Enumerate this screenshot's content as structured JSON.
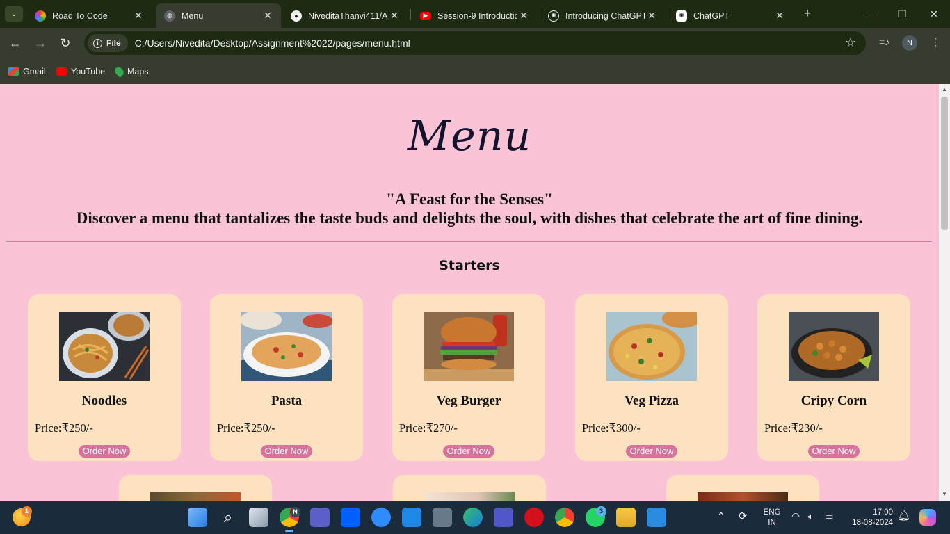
{
  "browser": {
    "tabs": [
      {
        "title": "Road To Code",
        "favicon": "rainbow-ring-icon",
        "color": "#f4b400"
      },
      {
        "title": "Menu",
        "favicon": "globe-icon",
        "color": "#9aa0a6",
        "active": true
      },
      {
        "title": "NiveditaThanvi411/A",
        "favicon": "github-icon",
        "color": "#ffffff"
      },
      {
        "title": "Session-9 Introductio",
        "favicon": "youtube-icon",
        "color": "#ff0000"
      },
      {
        "title": "Introducing ChatGPT",
        "favicon": "openai-icon",
        "color": "#ffffff"
      },
      {
        "title": "ChatGPT",
        "favicon": "openai-icon",
        "color": "#ffffff"
      }
    ],
    "address": {
      "scheme_label": "File",
      "url": "C:/Users/Nivedita/Desktop/Assignment%2022/pages/menu.html"
    },
    "profile_initial": "N",
    "bookmarks": [
      {
        "label": "Gmail",
        "icon": "gmail-icon",
        "color": "#ea4335"
      },
      {
        "label": "YouTube",
        "icon": "youtube-icon",
        "color": "#ff0000"
      },
      {
        "label": "Maps",
        "icon": "maps-icon",
        "color": "#34a853"
      }
    ]
  },
  "page": {
    "title": "Menu",
    "tagline_quote": "\"A Feast for the Senses\"",
    "tagline_text": "Discover a menu that tantalizes the taste buds and delights the soul, with dishes that celebrate the art of fine dining.",
    "section_title": "Starters",
    "order_label": "Order Now",
    "items": [
      {
        "name": "Noodles",
        "price": "Price:₹250/-",
        "image": "noodles-photo"
      },
      {
        "name": "Pasta",
        "price": "Price:₹250/-",
        "image": "pasta-photo"
      },
      {
        "name": "Veg Burger",
        "price": "Price:₹270/-",
        "image": "burger-photo"
      },
      {
        "name": "Veg Pizza",
        "price": "Price:₹300/-",
        "image": "pizza-photo"
      },
      {
        "name": "Cripy Corn",
        "price": "Price:₹230/-",
        "image": "corn-photo"
      }
    ]
  },
  "taskbar": {
    "weather_badge": "1",
    "chrome_badge": "N",
    "whatsapp_badge": "3",
    "lang_line1": "ENG",
    "lang_line2": "IN",
    "time": "17:00",
    "date": "18-08-2024"
  },
  "colors": {
    "page_bg": "#fbc4d6",
    "card_bg": "#fde2c2",
    "order_button": "#d8729a",
    "browser_frame": "#1f2a13",
    "taskbar_bg": "#1c2b3b"
  }
}
